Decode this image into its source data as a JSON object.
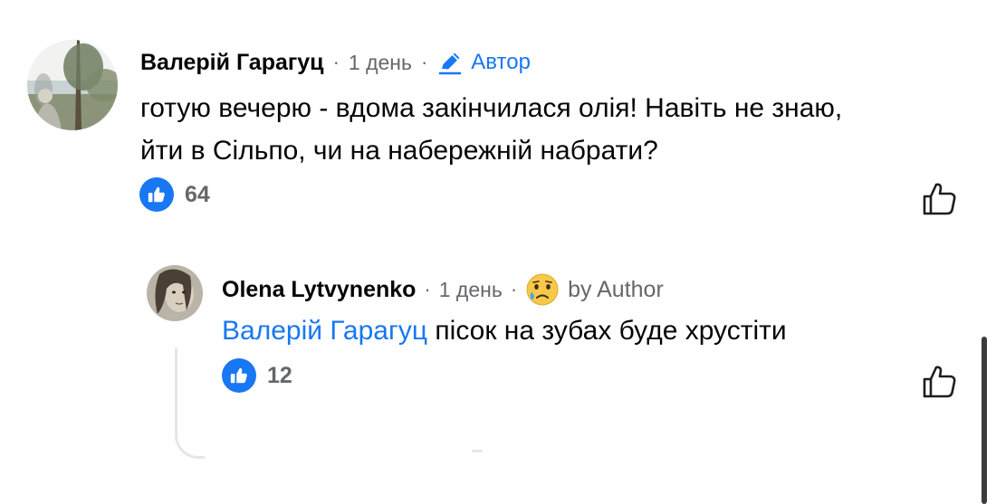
{
  "comment": {
    "author": "Валерій Гарагуц",
    "dot1": "·",
    "time": "1 день",
    "dot2": "·",
    "author_badge": "Автор",
    "text_line1": "готую вечерю - вдома закінчилася олія! Навіть не знаю,",
    "text_line2": "йти в Сільпо, чи на набережній набрати?",
    "reaction_count": "64",
    "avatar_icon": "lake-photo-avatar",
    "reaction_icon": "like-icon"
  },
  "reply": {
    "author": "Olena Lytvynenko",
    "dot1": "·",
    "time": "1 день",
    "dot2": "·",
    "emoji_icon": "crying-face-icon",
    "author_badge": "by Author",
    "mention": "Валерій Гарагуц",
    "text": " пісок на зубах буде хрустіти",
    "reaction_count": "12",
    "avatar_icon": "portrait-photo-avatar",
    "reaction_icon": "like-icon"
  },
  "colors": {
    "accent": "#1877f2",
    "meta": "#65676b",
    "text": "#050505"
  }
}
